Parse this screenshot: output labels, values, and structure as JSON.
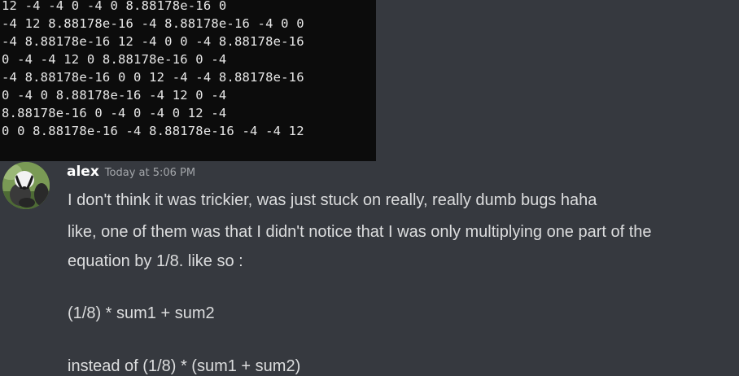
{
  "terminal": {
    "lines": [
      "12 -4 -4 0 -4 0 8.88178e-16 0",
      "-4 12 8.88178e-16 -4 8.88178e-16 -4 0 0",
      "-4 8.88178e-16 12 -4 0 0 -4 8.88178e-16",
      "0 -4 -4 12 0 8.88178e-16 0 -4",
      "-4 8.88178e-16 0 0 12 -4 -4 8.88178e-16",
      "0 -4 0 8.88178e-16 -4 12 0 -4",
      "8.88178e-16 0 -4 0 -4 0 12 -4",
      "0 0 8.88178e-16 -4 8.88178e-16 -4 -4 12"
    ]
  },
  "message": {
    "author": "alex",
    "timestamp": "Today at 5:06 PM",
    "lines": [
      "I don't think it was trickier, was just stuck on really, really dumb bugs haha",
      "like, one of them was that I didn't notice that I was only multiplying one part of the",
      "equation by 1/8. like so :",
      "(1/8) * sum1 + sum2",
      "instead of (1/8) * (sum1 + sum2)"
    ]
  },
  "colors": {
    "background": "#36393f",
    "terminal_bg": "#0c0c0c",
    "username": "#ffffff",
    "message_text": "#dcddde",
    "timestamp": "#a3a6aa"
  }
}
